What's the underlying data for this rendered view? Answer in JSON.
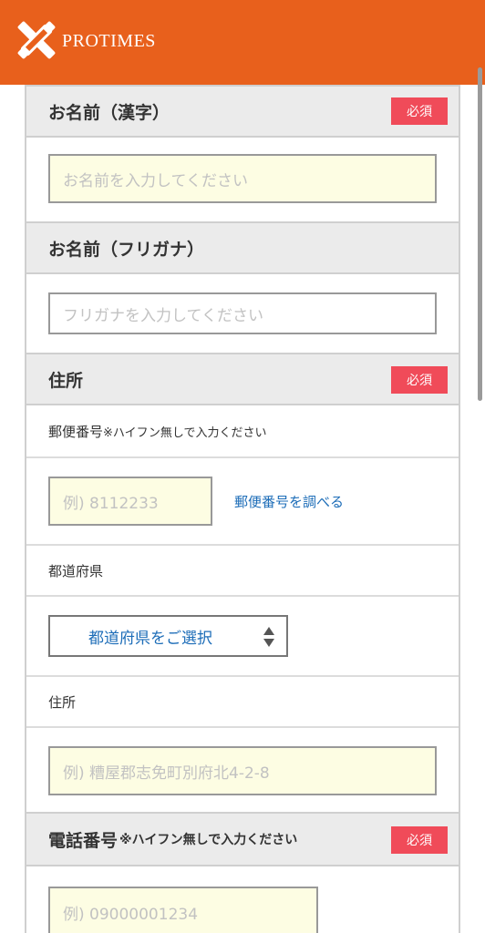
{
  "header": {
    "brand": "PROTIMES",
    "logo_icon": "protimes-logo-icon",
    "background_color": "#e8601c"
  },
  "form": {
    "required_label": "必須",
    "name_kanji": {
      "title": "お名前（漢字）",
      "placeholder": "お名前を入力してください"
    },
    "name_kana": {
      "title": "お名前（フリガナ）",
      "placeholder": "フリガナを入力してください"
    },
    "address": {
      "title": "住所",
      "postal_label": "郵便番号",
      "postal_note": "※ハイフン無しで入力ください",
      "postal_placeholder": "例) 8112233",
      "postal_lookup_link": "郵便番号を調べる",
      "prefecture_label": "都道府県",
      "prefecture_selected": "都道府県をご選択",
      "street_label": "住所",
      "street_placeholder": "例) 糟屋郡志免町別府北4-2-8"
    },
    "phone": {
      "title": "電話番号",
      "note": "※ハイフン無しで入力ください",
      "placeholder": "例) 09000001234"
    }
  },
  "colors": {
    "accent": "#e8601c",
    "required_badge": "#f04b59",
    "link": "#1d6db8",
    "input_fill": "#fdfde3"
  }
}
